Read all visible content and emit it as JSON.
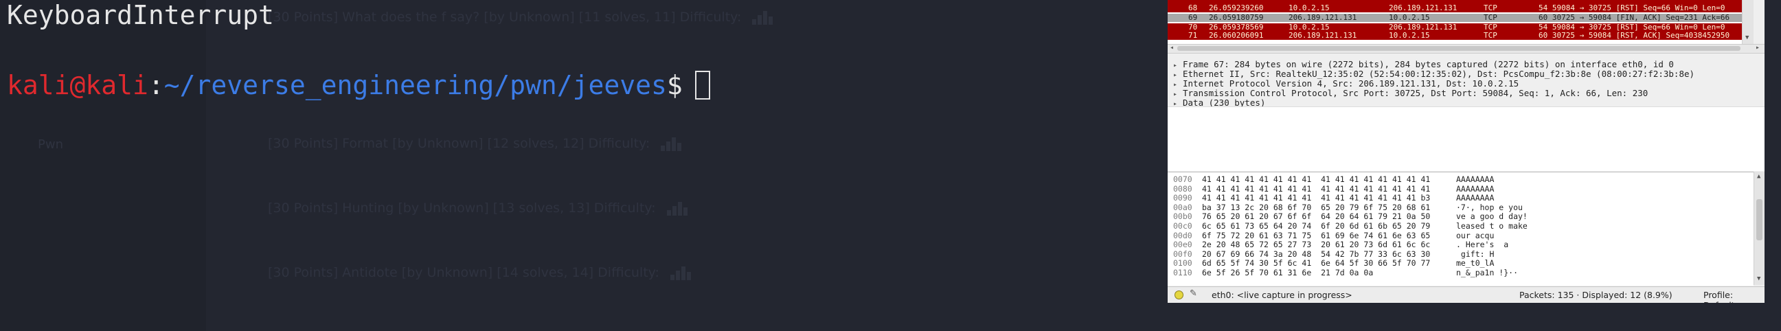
{
  "terminal": {
    "line1": "KeyboardInterrupt",
    "prompt_user": "kali@kali",
    "prompt_colon": ":",
    "prompt_path": "~/reverse_engineering/pwn/jeeves",
    "prompt_dollar": "$",
    "colors": {
      "user": "#e0292e",
      "path": "#3c7ce6",
      "text": "#e6e6e6",
      "bg": "#232630"
    }
  },
  "background_page": {
    "sidebar_items": [
      "Pwn"
    ],
    "rows": [
      "[30 Points] What does the f say? [by Unknown] [11 solves, 11]  Difficulty:",
      "[30 Points] Format [by Unknown] [12 solves, 12]  Difficulty:",
      "[30 Points] Hunting [by Unknown] [13 solves, 13]  Difficulty:",
      "[30 Points] Antidote [by Unknown] [14 solves, 14]  Difficulty:"
    ]
  },
  "wireshark": {
    "packets": [
      {
        "no": "68",
        "time": "26.059239260",
        "src": "10.0.2.15",
        "dst": "206.189.121.131",
        "proto": "TCP",
        "info": "54 59084 → 30725 [RST] Seq=66 Win=0 Len=0",
        "bg": "#a40000",
        "fg": "#fff3d6"
      },
      {
        "no": "69",
        "time": "26.059180759",
        "src": "206.189.121.131",
        "dst": "10.0.2.15",
        "proto": "TCP",
        "info": "60 30725 → 59084 [FIN, ACK] Seq=231 Ack=66",
        "bg": "#a8a8a8",
        "fg": "#1e1e1e"
      },
      {
        "no": "70",
        "time": "26.059378569",
        "src": "10.0.2.15",
        "dst": "206.189.121.131",
        "proto": "TCP",
        "info": "54 59084 → 30725 [RST] Seq=66 Win=0 Len=0",
        "bg": "#a40000",
        "fg": "#fff3d6"
      },
      {
        "no": "71",
        "time": "26.060206091",
        "src": "206.189.121.131",
        "dst": "10.0.2.15",
        "proto": "TCP",
        "info": "60 30725 → 59084 [RST, ACK] Seq=4038452950",
        "bg": "#a40000",
        "fg": "#fff3d6"
      }
    ],
    "details": [
      "Frame 67: 284 bytes on wire (2272 bits), 284 bytes captured (2272 bits) on interface eth0, id 0",
      "Ethernet II, Src: RealtekU_12:35:02 (52:54:00:12:35:02), Dst: PcsCompu_f2:3b:8e (08:00:27:f2:3b:8e)",
      "Internet Protocol Version 4, Src: 206.189.121.131, Dst: 10.0.2.15",
      "Transmission Control Protocol, Src Port: 30725, Dst Port: 59084, Seq: 1, Ack: 66, Len: 230",
      "Data (230 bytes)"
    ],
    "hex": [
      {
        "off": "0070",
        "bytes": "41 41 41 41 41 41 41 41  41 41 41 41 41 41 41 41",
        "ascii": "AAAAAAAA"
      },
      {
        "off": "0080",
        "bytes": "41 41 41 41 41 41 41 41  41 41 41 41 41 41 41 41",
        "ascii": "AAAAAAAA"
      },
      {
        "off": "0090",
        "bytes": "41 41 41 41 41 41 41 41  41 41 41 41 41 41 41 b3",
        "ascii": "AAAAAAAA"
      },
      {
        "off": "00a0",
        "bytes": "ba 37 13 2c 20 68 6f 70  65 20 79 6f 75 20 68 61",
        "ascii": "·7·, hop e you"
      },
      {
        "off": "00b0",
        "bytes": "76 65 20 61 20 67 6f 6f  64 20 64 61 79 21 0a 50",
        "ascii": "ve a goo d day!"
      },
      {
        "off": "00c0",
        "bytes": "6c 65 61 73 65 64 20 74  6f 20 6d 61 6b 65 20 79",
        "ascii": "leased t o make"
      },
      {
        "off": "00d0",
        "bytes": "6f 75 72 20 61 63 71 75  61 69 6e 74 61 6e 63 65",
        "ascii": "our acqu"
      },
      {
        "off": "00e0",
        "bytes": "2e 20 48 65 72 65 27 73  20 61 20 73 6d 61 6c 6c",
        "ascii": ". Here's  a"
      },
      {
        "off": "00f0",
        "bytes": "20 67 69 66 74 3a 20 48  54 42 7b 77 33 6c 63 30",
        "ascii": " gift: H"
      },
      {
        "off": "0100",
        "bytes": "6d 65 5f 74 30 5f 6c 41  6e 64 5f 30 66 5f 70 77",
        "ascii": "me_t0_lA"
      },
      {
        "off": "0110",
        "bytes": "6e 5f 26 5f 70 61 31 6e  21 7d 0a 0a",
        "ascii": "n_&_pa1n !}··"
      }
    ],
    "status": {
      "capture": "eth0: <live capture in progress>",
      "packets": "Packets: 135 · Displayed: 12 (8.9%)",
      "profile": "Profile: Default"
    }
  }
}
